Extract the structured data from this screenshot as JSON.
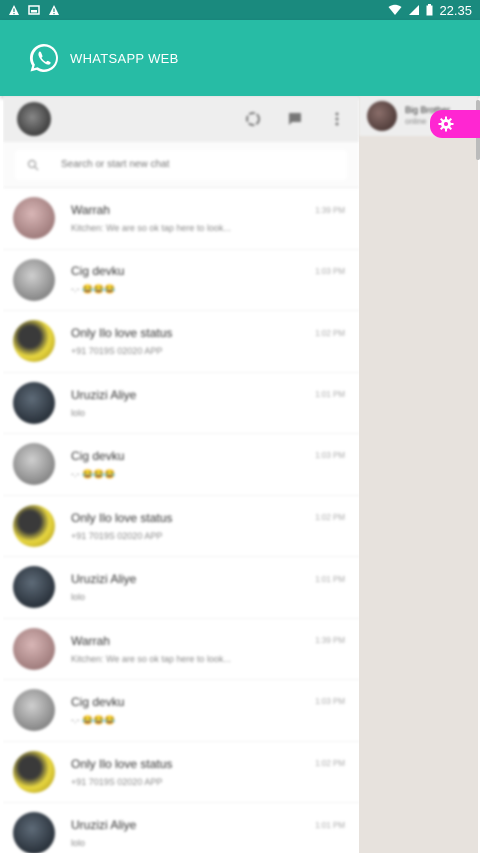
{
  "status_bar": {
    "time": "22.35",
    "left_icons": [
      "warning-icon",
      "image-icon",
      "warning-icon"
    ],
    "right_icons": [
      "wifi-icon",
      "signal-icon",
      "battery-icon"
    ]
  },
  "app_bar": {
    "title": "WHATSAPP WEB",
    "color": "#27bca5"
  },
  "whatsapp_web": {
    "header_icons": [
      "status-icon",
      "new-chat-icon",
      "menu-icon"
    ],
    "search": {
      "placeholder": "Search or start new chat",
      "value": ""
    },
    "chats": [
      {
        "name": "Warrah",
        "time": "1:39 PM",
        "message": "Kitchen: We are so ok tap here to look...",
        "avatar": "pink"
      },
      {
        "name": "Cig devku",
        "time": "1:03 PM",
        "message": "-.-  😂😂😂",
        "avatar": "grey"
      },
      {
        "name": "Only Ilo love status",
        "time": "1:02 PM",
        "message": "+91 7019S 02020 APP",
        "avatar": "yellow"
      },
      {
        "name": "Uruzizi Aliye",
        "time": "1:01 PM",
        "message": "lolo",
        "avatar": "dark"
      },
      {
        "name": "Cig devku",
        "time": "1:03 PM",
        "message": "-.-  😂😂😂",
        "avatar": "grey"
      },
      {
        "name": "Only Ilo love status",
        "time": "1:02 PM",
        "message": "+91 7019S 02020 APP",
        "avatar": "yellow"
      },
      {
        "name": "Uruzizi Aliye",
        "time": "1:01 PM",
        "message": "lolo",
        "avatar": "dark"
      },
      {
        "name": "Warrah",
        "time": "1:39 PM",
        "message": "Kitchen: We are so ok tap here to look...",
        "avatar": "pink"
      },
      {
        "name": "Cig devku",
        "time": "1:03 PM",
        "message": "-.-  😂😂😂",
        "avatar": "grey"
      },
      {
        "name": "Only Ilo love status",
        "time": "1:02 PM",
        "message": "+91 7019S 02020 APP",
        "avatar": "yellow"
      },
      {
        "name": "Uruzizi Aliye",
        "time": "1:01 PM",
        "message": "lolo",
        "avatar": "dark"
      }
    ],
    "open_chat": {
      "name": "Big Brother",
      "subtitle": "online"
    }
  },
  "floating_button": {
    "icon": "gear-icon",
    "color": "#ff26d2"
  }
}
